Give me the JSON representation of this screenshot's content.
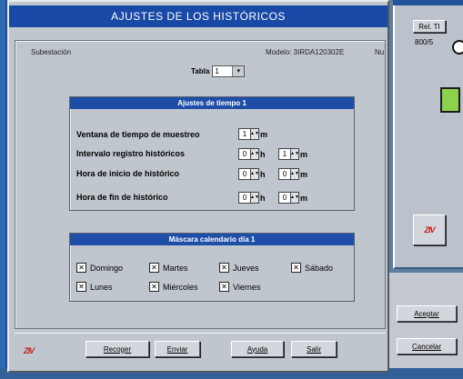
{
  "dialog": {
    "title": "AJUSTES DE LOS HISTÓRICOS",
    "subestacion_label": "Subestación",
    "modelo_label": "Modelo: 3IRDA120302E",
    "nu_label": "Nu",
    "tabla_label": "Tabla",
    "tabla_value": "1"
  },
  "tiempo_group": {
    "title": "Ajustes de tiempo 1",
    "rows": [
      {
        "label": "Ventana de tiempo de muestreo",
        "v1": "1",
        "u1": "m"
      },
      {
        "label": "Intervalo registro históricos",
        "v1": "0",
        "u1": "h",
        "v2": "1",
        "u2": "m"
      },
      {
        "label": "Hora de inicio de histórico",
        "v1": "0",
        "u1": "h",
        "v2": "0",
        "u2": "m"
      },
      {
        "label": "Hora de fin de histórico",
        "v1": "0",
        "u1": "h",
        "v2": "0",
        "u2": "m"
      }
    ]
  },
  "calendario_group": {
    "title": "Máscara calendario día 1",
    "days": [
      {
        "label": "Domingo",
        "checked": true
      },
      {
        "label": "Martes",
        "checked": true
      },
      {
        "label": "Jueves",
        "checked": true
      },
      {
        "label": "Sábado",
        "checked": true
      },
      {
        "label": "Lunes",
        "checked": true
      },
      {
        "label": "Miércoles",
        "checked": true
      },
      {
        "label": "Viernes",
        "checked": true
      }
    ]
  },
  "buttons": {
    "recoger": "Recoger",
    "enviar": "Enviar",
    "ayuda": "Ayuda",
    "salir": "Salir",
    "aceptar": "Aceptar",
    "cancelar": "Cancelar"
  },
  "background_window": {
    "rel_ti": "Rel. TI",
    "ratio": "800/5"
  },
  "logo": "ZIV",
  "colors": {
    "title_bar": "#1849a6",
    "group_header": "#1e4ea8",
    "indicator": "#8cd24f",
    "logo": "#c8201c"
  }
}
